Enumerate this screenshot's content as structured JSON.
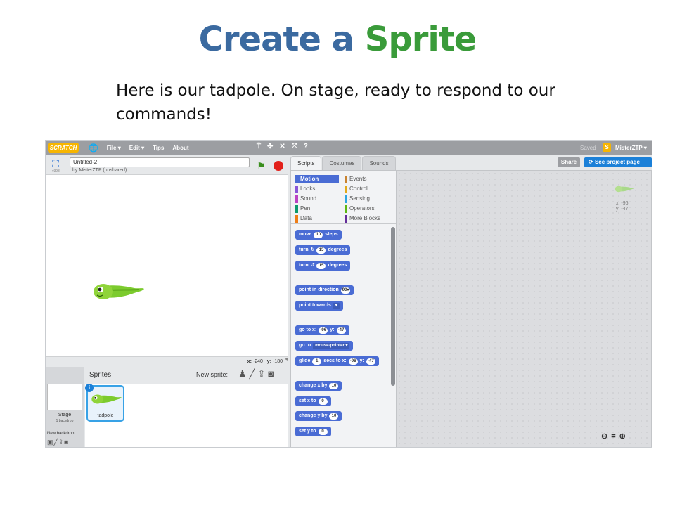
{
  "slide": {
    "title_part1": "Create a",
    "title_part2": "Sprite",
    "subtitle": "Here is our tadpole. On stage, ready to respond to our commands!"
  },
  "menubar": {
    "logo": "SCRATCH",
    "items": [
      "File ▾",
      "Edit ▾",
      "Tips",
      "About"
    ],
    "saved": "Saved",
    "user": "MisterZTP ▾"
  },
  "project": {
    "title": "Untitled-2",
    "owner": "by MisterZTP (unshared)",
    "version": "v398"
  },
  "stage": {
    "coords_x_label": "x:",
    "coords_x": "-240",
    "coords_y_label": "y:",
    "coords_y": "-180"
  },
  "sprites": {
    "header": "Sprites",
    "new_sprite": "New sprite:",
    "stage_label": "Stage",
    "stage_sub": "1 backdrop",
    "new_backdrop": "New backdrop:",
    "list": [
      {
        "name": "tadpole"
      }
    ]
  },
  "tabs": [
    "Scripts",
    "Costumes",
    "Sounds"
  ],
  "categories": {
    "left": [
      {
        "label": "Motion",
        "color": "#4a6cd4"
      },
      {
        "label": "Looks",
        "color": "#8a55d7"
      },
      {
        "label": "Sound",
        "color": "#bb42c3"
      },
      {
        "label": "Pen",
        "color": "#0e9a6c"
      },
      {
        "label": "Data",
        "color": "#ee7d16"
      }
    ],
    "right": [
      {
        "label": "Events",
        "color": "#c88330"
      },
      {
        "label": "Control",
        "color": "#e1a91a"
      },
      {
        "label": "Sensing",
        "color": "#2ca5e2"
      },
      {
        "label": "Operators",
        "color": "#5cb712"
      },
      {
        "label": "More Blocks",
        "color": "#632d99"
      }
    ]
  },
  "blocks": {
    "move": {
      "a": "move",
      "v": "10",
      "b": "steps"
    },
    "turn_right": {
      "a": "turn",
      "icon": "↻",
      "v": "15",
      "b": "degrees"
    },
    "turn_left": {
      "a": "turn",
      "icon": "↺",
      "v": "15",
      "b": "degrees"
    },
    "point_dir": {
      "a": "point in direction",
      "v": "90▾"
    },
    "point_towards": {
      "a": "point towards",
      "dd": "▾"
    },
    "goto_xy": {
      "a": "go to x:",
      "x": "-96",
      "b": "y:",
      "y": "-47"
    },
    "goto": {
      "a": "go to",
      "dd": "mouse-pointer ▾"
    },
    "glide": {
      "a": "glide",
      "s": "1",
      "b": "secs to x:",
      "x": "-96",
      "c": "y:",
      "y": "-47"
    },
    "change_x": {
      "a": "change x by",
      "v": "10"
    },
    "set_x": {
      "a": "set x to",
      "v": "0"
    },
    "change_y": {
      "a": "change y by",
      "v": "10"
    },
    "set_y": {
      "a": "set y to",
      "v": "0"
    }
  },
  "scripts_area": {
    "share": "Share",
    "see_project": "See project page",
    "sprite_x": "x: -96",
    "sprite_y": "y: -47"
  },
  "colors": {
    "title_blue": "#3b6aa0",
    "title_green": "#3a9b3a",
    "motion_blue": "#4a6cd4",
    "tadpole_green": "#7ccb2e"
  }
}
